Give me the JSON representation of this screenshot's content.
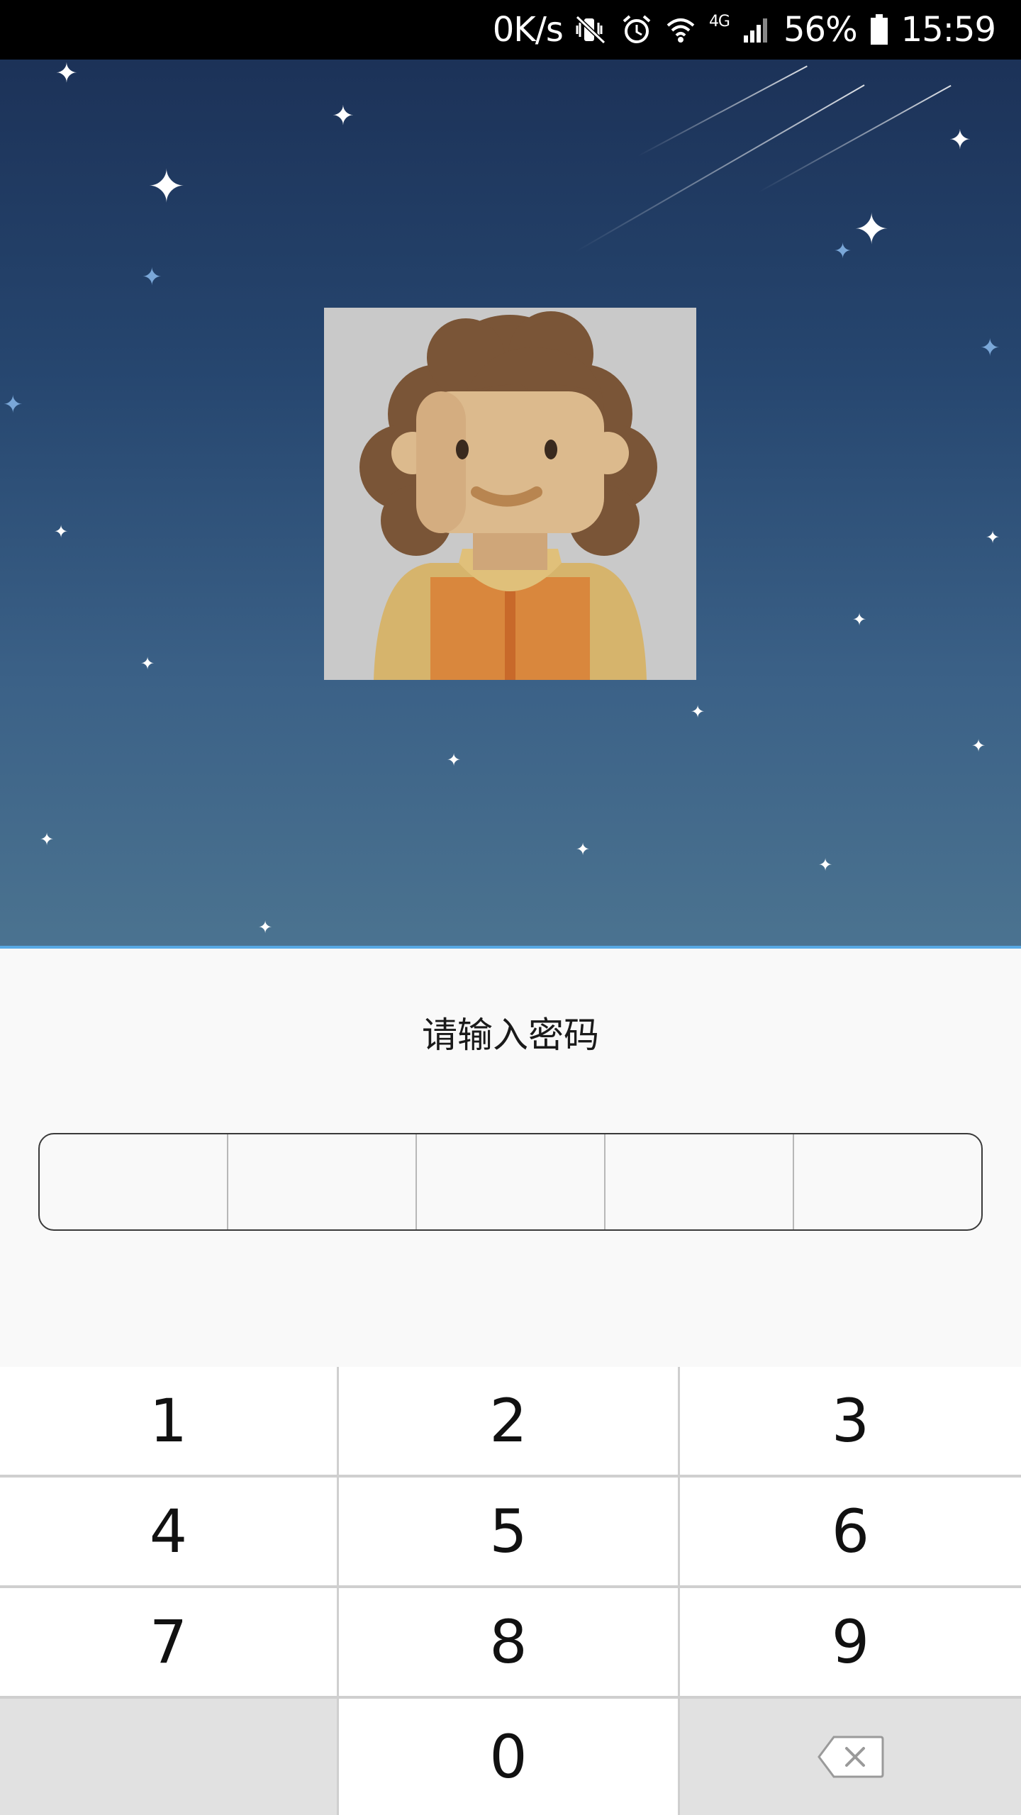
{
  "status_bar": {
    "net_speed": "0K/s",
    "network_type": "4G",
    "battery": "56%",
    "time": "15:59",
    "icons": [
      "mute-vibrate-icon",
      "alarm-icon",
      "wifi-icon",
      "signal-icon",
      "battery-icon"
    ]
  },
  "prompt": {
    "title": "请输入密码"
  },
  "pin": {
    "length": 5
  },
  "keypad": {
    "keys": [
      "1",
      "2",
      "3",
      "4",
      "5",
      "6",
      "7",
      "8",
      "9",
      "",
      "0",
      "backspace"
    ]
  },
  "colors": {
    "accent_line": "#57a9e4",
    "hero_top": "#1c3258",
    "hero_bottom": "#4b7390",
    "keypad_gray": "#e1e1e1"
  }
}
